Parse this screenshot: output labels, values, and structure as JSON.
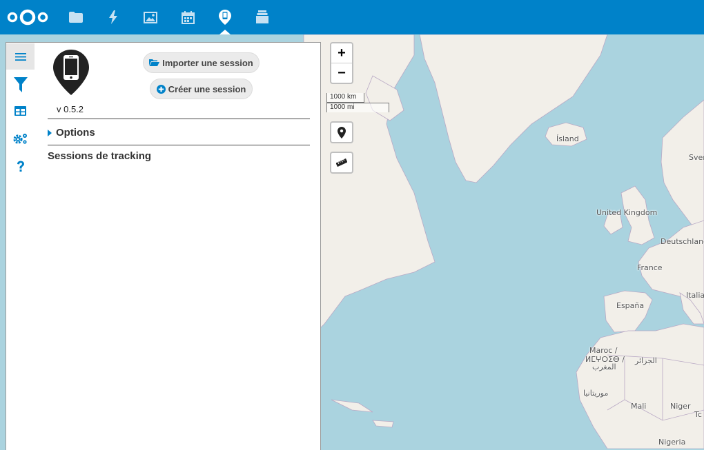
{
  "topbar": {
    "apps": [
      {
        "name": "files-icon"
      },
      {
        "name": "activity-icon"
      },
      {
        "name": "gallery-icon"
      },
      {
        "name": "calendar-icon"
      },
      {
        "name": "phonetrack-icon"
      },
      {
        "name": "deck-icon"
      }
    ],
    "active_app": "phonetrack-icon",
    "bar_color": "#0082c9"
  },
  "sidebar": {
    "tabs": [
      "menu-icon",
      "filter-icon",
      "table-icon",
      "settings-icon",
      "help-icon"
    ],
    "version": "v 0.5.2",
    "import_label": "Importer une session",
    "create_label": "Créer une session",
    "options_label": "Options",
    "sessions_label": "Sessions de tracking"
  },
  "map": {
    "zoom_in": "+",
    "zoom_out": "−",
    "scale_km": "1000 km",
    "scale_mi": "1000 mi",
    "labels": {
      "island": "Ísland",
      "sverige": "Sver",
      "uk": "United Kingdom",
      "deutschland": "Deutschland",
      "france": "France",
      "italia": "Italia",
      "espana": "España",
      "maroc1": "Maroc /",
      "maroc2": "ⵍⵎⵖⵔⵉⴱ /",
      "maroc3": "المغرب",
      "algerie": "الجزائر",
      "mauritanie": "موريتانيا",
      "mali": "Mali",
      "niger": "Niger",
      "tchad": "Tc",
      "nigeria": "Nigeria"
    }
  }
}
